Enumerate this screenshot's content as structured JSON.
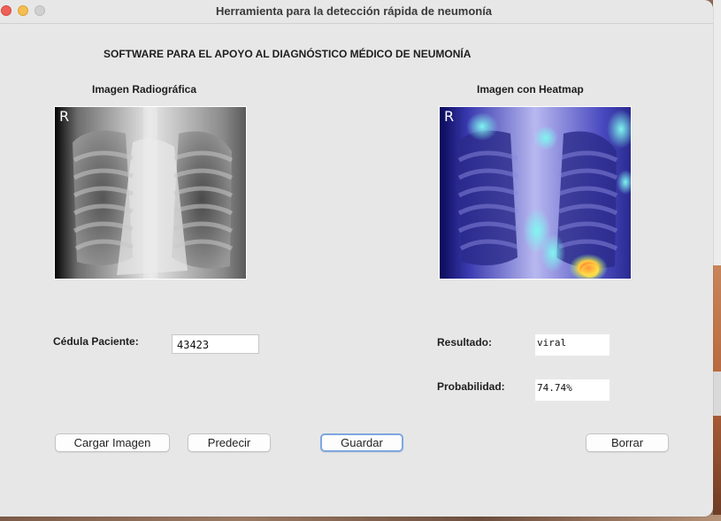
{
  "window": {
    "title": "Herramienta para la detección rápida de neumonía"
  },
  "app": {
    "title": "SOFTWARE PARA EL APOYO AL DIAGNÓSTICO MÉDICO DE NEUMONÍA"
  },
  "images": {
    "radiograph_label": "Imagen Radiográfica",
    "heatmap_label": "Imagen con Heatmap",
    "marker": "R"
  },
  "form": {
    "cedula_label": "Cédula Paciente:",
    "cedula_value": "43423",
    "resultado_label": "Resultado:",
    "resultado_value": "viral",
    "probabilidad_label": "Probabilidad:",
    "probabilidad_value": "74.74%"
  },
  "buttons": {
    "cargar": "Cargar Imagen",
    "predecir": "Predecir",
    "guardar": "Guardar",
    "borrar": "Borrar"
  },
  "colors": {
    "window_bg": "#e7e7e7",
    "close": "#ee5f57",
    "minimize": "#f5bd4f",
    "focus_ring": "#7ea6e0"
  }
}
